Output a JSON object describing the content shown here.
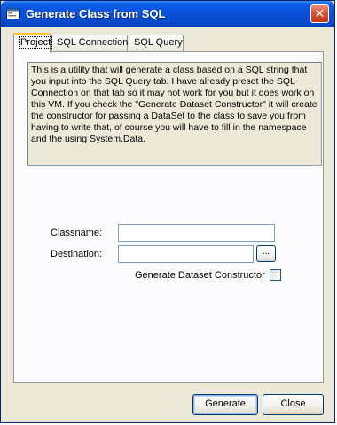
{
  "window": {
    "title": "Generate Class from SQL",
    "close_glyph": "✕"
  },
  "tabs": [
    {
      "label": "Project",
      "active": true
    },
    {
      "label": "SQL Connection",
      "active": false
    },
    {
      "label": "SQL Query",
      "active": false
    }
  ],
  "project": {
    "description": "This is a utility that will generate a class based on a SQL string that you input into the SQL Query tab.  I have already preset the SQL Connection on that tab so it may not work for you but it does work on this VM.  If you check the \"Generate Dataset Constructor\" it will create the constructor for passing a DataSet to the class to save you from having to write that, of course you will have to fill in the namespace and the using System.Data.",
    "classname_label": "Classname:",
    "classname_value": "",
    "destination_label": "Destination:",
    "destination_value": "",
    "browse_label": "...",
    "dataset_label": "Generate Dataset Constructor",
    "dataset_checked": false
  },
  "buttons": {
    "generate": "Generate",
    "close": "Close"
  },
  "colors": {
    "titlebar": "#0a4fd8",
    "face": "#ece9d8",
    "close_button": "#d9542e"
  },
  "icons": {
    "app": "window-app-icon",
    "close": "close-icon"
  }
}
